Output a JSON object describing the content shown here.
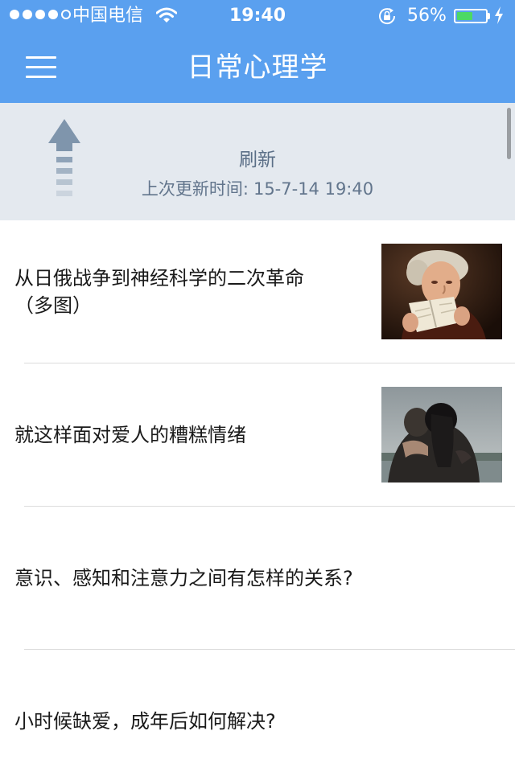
{
  "status_bar": {
    "carrier": "中国电信",
    "time": "19:40",
    "battery_percent": "56%",
    "battery_level": 0.56,
    "icons": [
      "signal-dots",
      "wifi-icon",
      "rotation-lock-icon",
      "battery-icon",
      "charging-bolt-icon"
    ]
  },
  "nav": {
    "title": "日常心理学",
    "menu_icon": "hamburger-menu-icon"
  },
  "refresh": {
    "label": "刷新",
    "last_update_label": "上次更新时间:",
    "last_update_value": "15-7-14 19:40",
    "icon": "pull-up-arrow-icon"
  },
  "articles": [
    {
      "line1": "从日俄战争到神经科学的二次革命",
      "line2": "（多图）",
      "thumbnail": "man-reading-portrait"
    },
    {
      "line1": "就这样面对爱人的糟糕情绪",
      "line2": "",
      "thumbnail": "couple-embracing-photo"
    },
    {
      "line1": "意识、感知和注意力之间有怎样的关系?",
      "line2": "",
      "thumbnail": ""
    },
    {
      "line1": "小时候缺爱，成年后如何解决?",
      "line2": "",
      "thumbnail": ""
    }
  ],
  "colors": {
    "nav_background": "#5aa0ef",
    "refresh_background": "#e4e9ef",
    "refresh_text": "#5b6f87",
    "battery_fill": "#4cd964",
    "divider": "#dcdcdc"
  }
}
